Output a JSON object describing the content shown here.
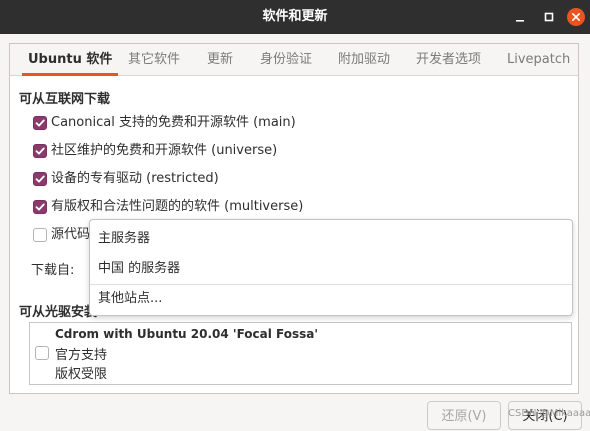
{
  "window": {
    "title": "软件和更新"
  },
  "tabs": [
    {
      "label": "Ubuntu 软件",
      "active": true
    },
    {
      "label": "其它软件"
    },
    {
      "label": "更新"
    },
    {
      "label": "身份验证"
    },
    {
      "label": "附加驱动"
    },
    {
      "label": "开发者选项"
    },
    {
      "label": "Livepatch"
    }
  ],
  "internet": {
    "heading": "可从互联网下载",
    "options": [
      {
        "label": "Canonical 支持的免费和开源软件 (main)",
        "checked": true
      },
      {
        "label": "社区维护的免费和开源软件 (universe)",
        "checked": true
      },
      {
        "label": "设备的专有驱动 (restricted)",
        "checked": true
      },
      {
        "label": "有版权和合法性问题的的软件 (multiverse)",
        "checked": true
      },
      {
        "label": "源代码",
        "checked": false
      }
    ],
    "download_from_label": "下载自:"
  },
  "server_menu": {
    "items": [
      "主服务器",
      "中国 的服务器",
      "其他站点..."
    ]
  },
  "cdrom": {
    "heading": "可从光驱安装",
    "name": "Cdrom with Ubuntu 20.04 'Focal Fossa'",
    "line1": "官方支持",
    "line2": "版权受限",
    "checked": false
  },
  "buttons": {
    "revert": "还原(V)",
    "close": "关闭(C)"
  },
  "watermark": "CSDN @Mikaaaa",
  "colors": {
    "titlebar": "#2f2f2f",
    "accent": "#e95420",
    "checkbox": "#8a3b6b"
  }
}
